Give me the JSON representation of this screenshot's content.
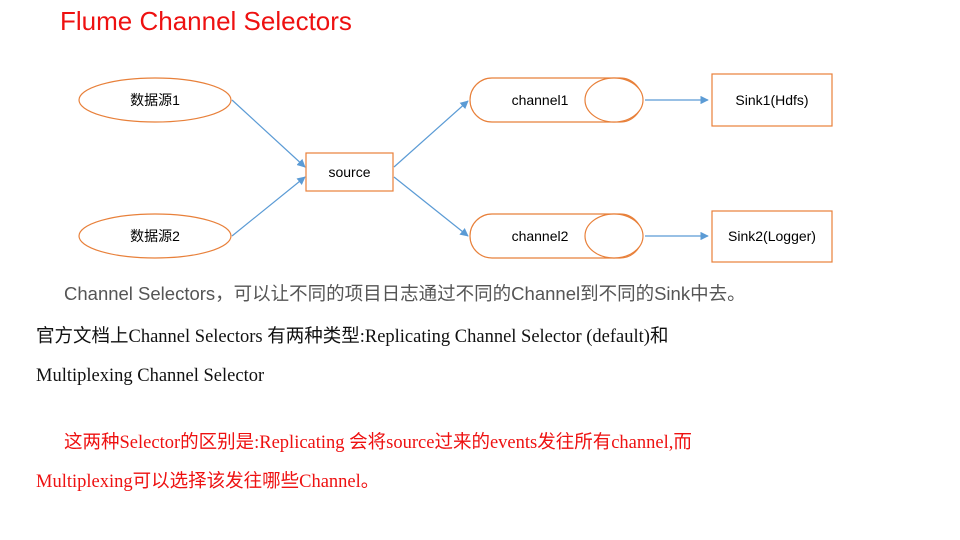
{
  "title": "Flume Channel Selectors",
  "diagram": {
    "sources": [
      "数据源1",
      "数据源2"
    ],
    "source": "source",
    "channels": [
      "channel1",
      "channel2"
    ],
    "sinks": [
      "Sink1(Hdfs)",
      "Sink2(Logger)"
    ],
    "colors": {
      "shape_stroke": "#e8803a",
      "arrow": "#5b9bd5"
    }
  },
  "text": {
    "para1": "Channel Selectors，可以让不同的项目日志通过不同的Channel到不同的Sink中去。",
    "para2_line1": "官方文档上Channel  Selectors  有两种类型:Replicating  Channel  Selector  (default)和",
    "para2_line2": "Multiplexing  Channel  Selector",
    "para3_line1": "这两种Selector的区别是:Replicating  会将source过来的events发往所有channel,而",
    "para3_line2": "Multiplexing可以选择该发往哪些Channel。"
  }
}
